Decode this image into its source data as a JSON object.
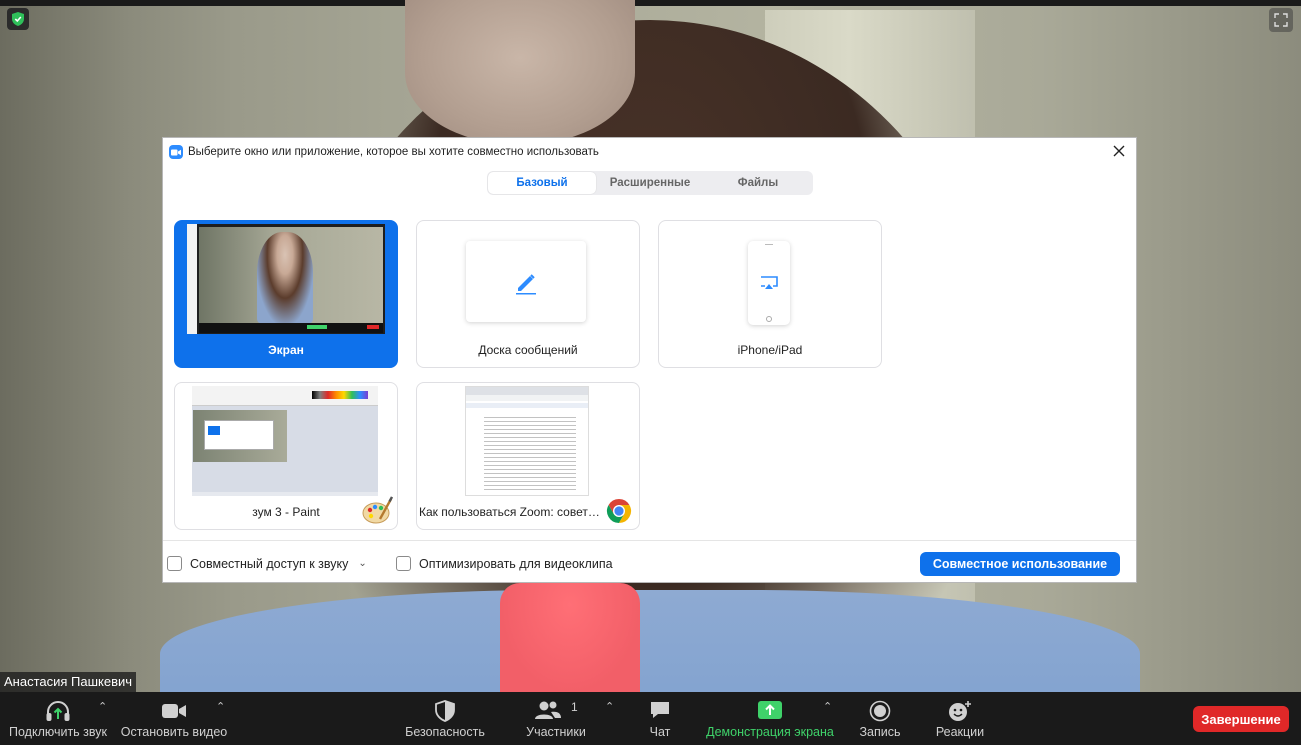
{
  "participant_name": "Анастасия Пашкевич",
  "dialog": {
    "title": "Выберите окно или приложение, которое вы хотите совместно использовать",
    "tabs": [
      "Базовый",
      "Расширенные",
      "Файлы"
    ],
    "active_tab": "Базовый",
    "tiles": [
      {
        "label": "Экран",
        "selected": true
      },
      {
        "label": "Доска сообщений",
        "selected": false
      },
      {
        "label": "iPhone/iPad",
        "selected": false
      },
      {
        "label": "зум 3 - Paint",
        "selected": false
      },
      {
        "label": "Как пользоваться Zoom: советы...",
        "selected": false
      }
    ],
    "share_audio_label": "Совместный доступ к звуку",
    "optimize_video_label": "Оптимизировать для видеоклипа",
    "share_button": "Совместное использование"
  },
  "toolbar": {
    "audio": "Подключить звук",
    "video": "Остановить видео",
    "security": "Безопасность",
    "participants": "Участники",
    "participants_count": "1",
    "chat": "Чат",
    "share_screen": "Демонстрация экрана",
    "record": "Запись",
    "reactions": "Реакции",
    "end": "Завершение"
  },
  "colors": {
    "accent": "#0e71eb",
    "share_green": "#3fd26a",
    "end_red": "#e02828"
  }
}
